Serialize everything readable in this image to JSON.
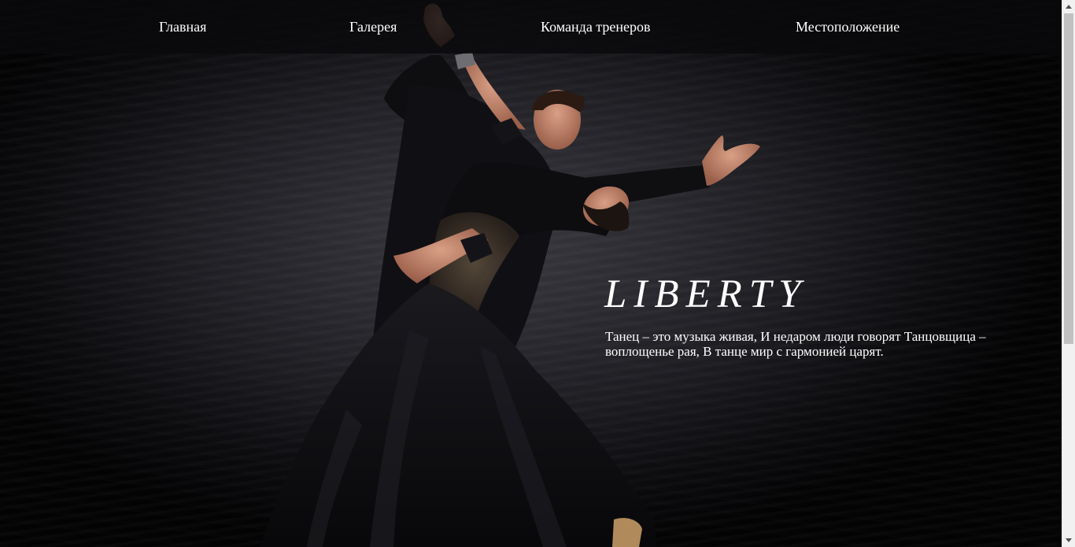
{
  "nav": {
    "items": [
      {
        "label": "Главная"
      },
      {
        "label": "Галерея"
      },
      {
        "label": "Команда тренеров"
      },
      {
        "label": "Местоположение"
      }
    ]
  },
  "hero": {
    "title": "LIBERTY",
    "text": "Танец – это музыка живая, И недаром люди говорят Танцовщица – воплощенье рая, В танце мир с гармонией царят.",
    "image_icon": "ballroom-dancers-image"
  },
  "colors": {
    "nav_text": "#ffffff",
    "nav_bar": "#0a0a0c",
    "backdrop": "#2b2b31",
    "dress": "#0d0d10",
    "skin": "#c98c73"
  }
}
